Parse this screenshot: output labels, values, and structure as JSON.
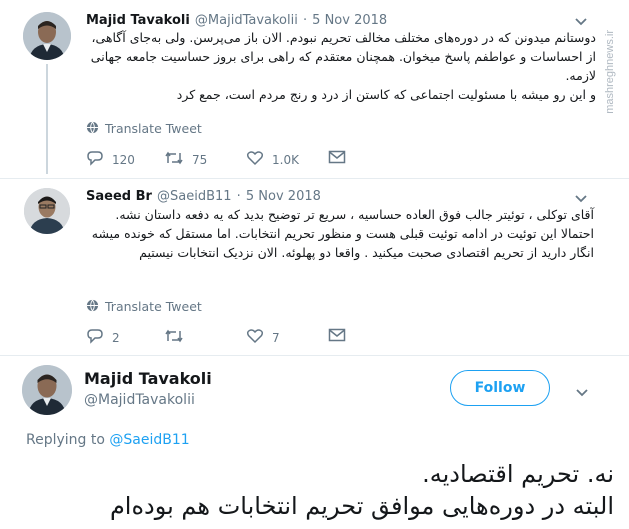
{
  "watermark": "mashreghnews.ir",
  "tweet1": {
    "author_name": "Majid Tavakoli",
    "handle": "@MajidTavakolii",
    "sep": "·",
    "date": "5 Nov 2018",
    "text": "دوستانم میدونن که در دوره‌های مختلف مخالف تحریم نبودم. الان باز می‌پرسن. ولی به‌جای آگاهی، از احساسات و عواطفم پاسخ میخوان. همچنان معتقدم که راهی برای بروز حساسیت جامعه جهانی لازمه.\nو این رو میشه با مسئولیت اجتماعی که کاستن از درد و رنج مردم است، جمع کرد",
    "translate": "Translate Tweet",
    "replies": "120",
    "retweets": "75",
    "likes": "1.0K"
  },
  "tweet2": {
    "author_name": "Saeed Br",
    "handle": "@SaeidB11",
    "sep": "·",
    "date": "5 Nov 2018",
    "text": "آقای توکلی ، توئیتر جالب فوق العاده حساسیه ، سریع تر توضیح بدید که یه دفعه داستان نشه. احتمالا این توئیت در ادامه توئیت قبلی هست و منظور تحریم انتخابات. اما مستقل که خونده میشه انگار دارید از تحریم اقتصادی صحبت میکنید . واقعا دو پهلوئه. الان نزدیک انتخابات نیستیم",
    "translate": "Translate Tweet",
    "replies": "2",
    "retweets": "",
    "likes": "7"
  },
  "main_tweet": {
    "author_name": "Majid Tavakoli",
    "handle": "@MajidTavakolii",
    "follow_label": "Follow",
    "replying_prefix": "Replying to",
    "replying_handle": "@SaeidB11",
    "line1": "نه. تحریم اقتصادیه.",
    "line2": "البته در دوره‌هایی موافق تحریم انتخابات هم بوده‌ام"
  },
  "colors": {
    "accent": "#1da1f2",
    "muted": "#657786",
    "text": "#14171a"
  },
  "icons": [
    "chevron-down-icon",
    "globe-icon",
    "reply-icon",
    "retweet-icon",
    "heart-icon",
    "mail-icon"
  ]
}
